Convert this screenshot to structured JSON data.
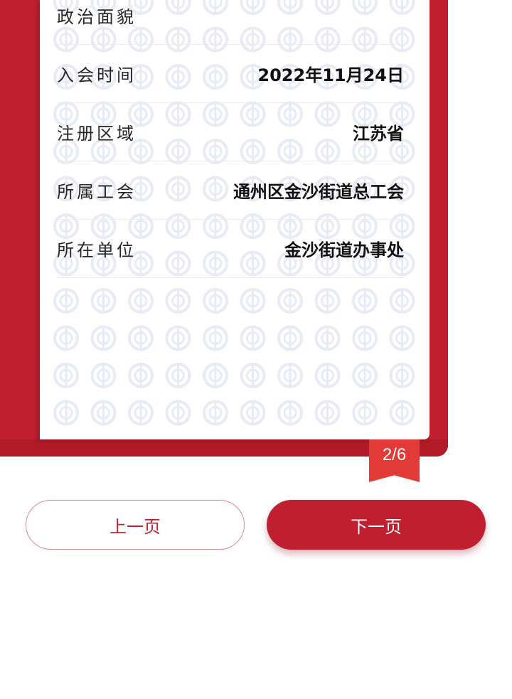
{
  "colors": {
    "brand_red": "#c01f2f",
    "ribbon_red": "#e23a37",
    "watermark": "#e8ebf5"
  },
  "info_rows": [
    {
      "label": "政治面貌",
      "value": ""
    },
    {
      "label": "入会时间",
      "value": "2022年11月24日"
    },
    {
      "label": "注册区域",
      "value": "江苏省"
    },
    {
      "label": "所属工会",
      "value": "通州区金沙街道总工会"
    },
    {
      "label": "所在单位",
      "value": "金沙街道办事处"
    }
  ],
  "pagination": {
    "indicator": "2/6",
    "prev_label": "上一页",
    "next_label": "下一页"
  },
  "watermark_icon": "union-emblem-icon"
}
